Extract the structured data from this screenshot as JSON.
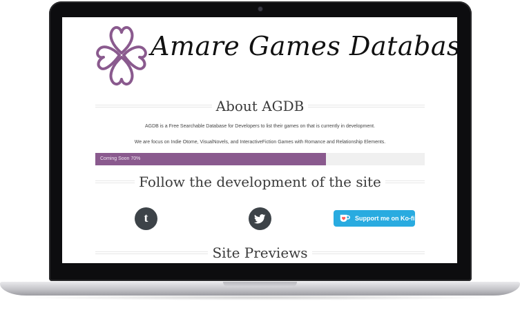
{
  "site": {
    "title": "Amare Games Database"
  },
  "about": {
    "heading": "About AGDB",
    "line1": "AGDB is a Free Searchable Database for Developers to list their games on that is currently in development.",
    "line2": "We are focus on Indie Otome, VisualNovels, and InteractiveFiction Games with Romance and Relationship Elements."
  },
  "progress": {
    "label": "Coming Soon 70%",
    "value": 0.7,
    "fill_color": "#8a5a8e"
  },
  "follow": {
    "heading": "Follow the development of the site",
    "links": [
      {
        "icon": "tumblr-icon",
        "glyph": "t"
      },
      {
        "icon": "twitter-icon"
      }
    ],
    "kofi_label": "Support me on Ko-fi"
  },
  "previews": {
    "heading": "Site Previews"
  },
  "colors": {
    "accent": "#8a5a8e",
    "social_icon_bg": "#3d4348",
    "kofi_blue": "#29abe0"
  }
}
